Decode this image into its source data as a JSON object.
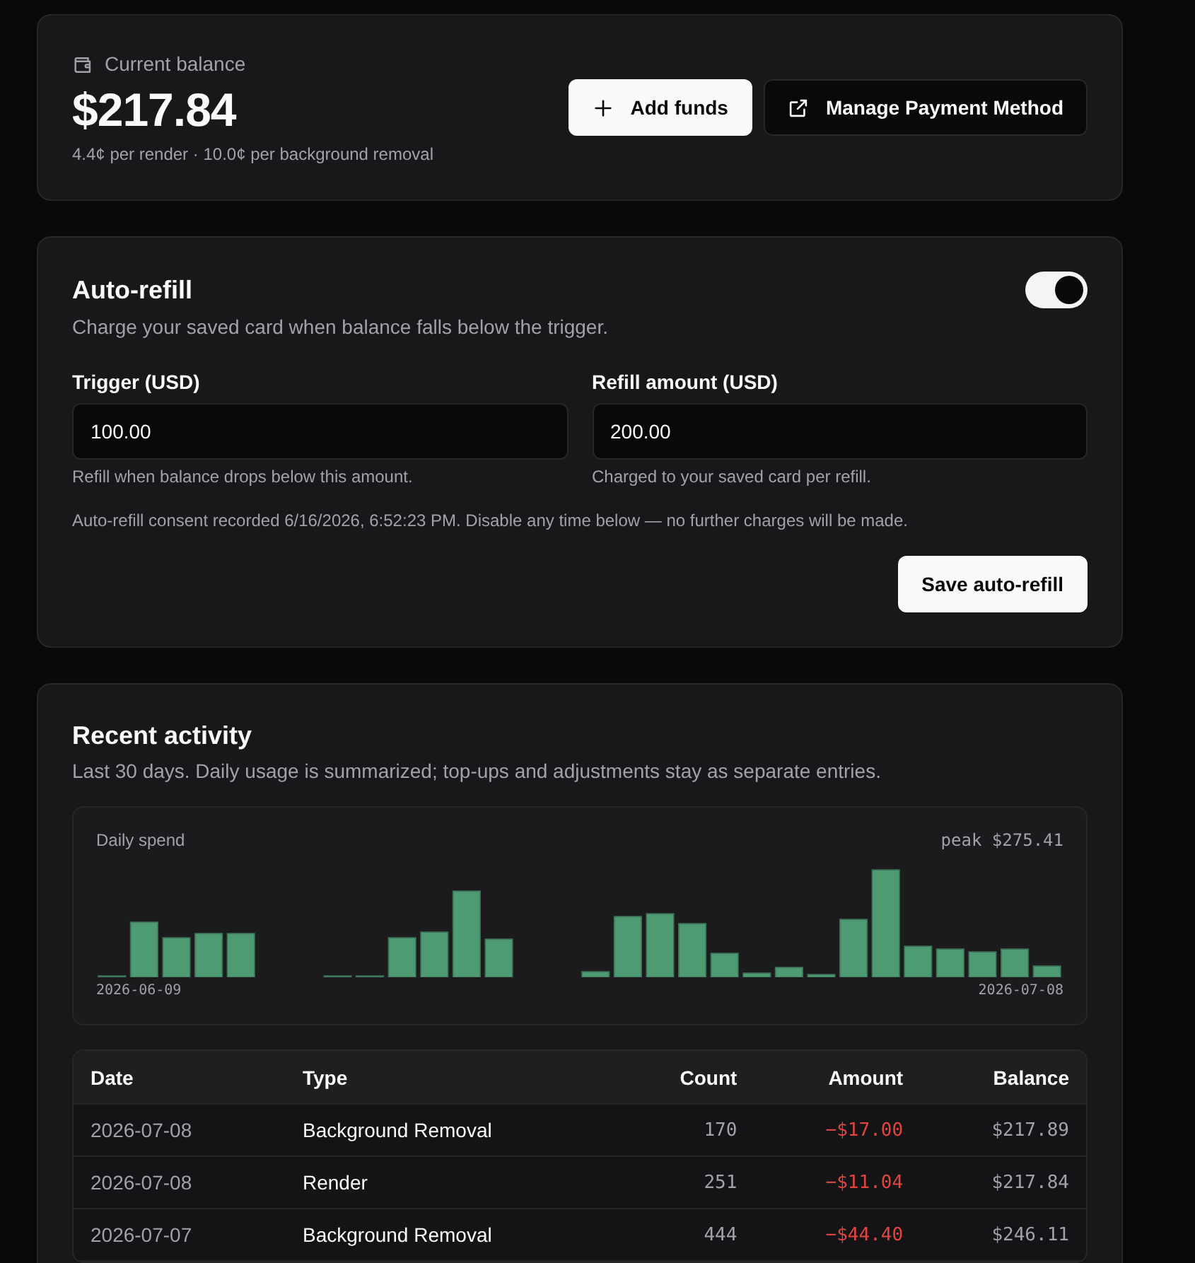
{
  "balance_card": {
    "label": "Current balance",
    "amount": "$217.84",
    "rates": "4.4¢ per render · 10.0¢ per background removal",
    "buttons": [
      {
        "label": "Add funds",
        "kind": "add"
      },
      {
        "label": "Manage Payment Method",
        "kind": "link"
      }
    ]
  },
  "auto_refill": {
    "title": "Auto-refill",
    "description": "Charge your saved card when balance falls below the trigger.",
    "on": true,
    "fields": [
      {
        "label": "Trigger (USD)",
        "value": "100.00",
        "hint": "Refill when balance drops below this amount."
      },
      {
        "label": "Refill amount (USD)",
        "value": "200.00",
        "hint": "Charged to your saved card per refill."
      }
    ],
    "consent": "Auto-refill consent recorded 6/16/2026, 6:52:23 PM. Disable any time below — no further charges will be made.",
    "save_button": "Save auto-refill"
  },
  "activity": {
    "title": "Recent activity",
    "description": "Last 30 days. Daily usage is summarized; top-ups and adjustments stay as separate entries.",
    "chart": {
      "title": "Daily spend",
      "peak": "peak $275.41",
      "start_date": "2026-06-09",
      "end_date": "2026-07-08"
    },
    "table": {
      "columns": [
        "Date",
        "Type",
        "Count",
        "Amount",
        "Balance"
      ],
      "rows": [
        {
          "date": "2026-07-08",
          "type": "Background Removal",
          "count": "170",
          "amount": "−$17.00",
          "balance": "$217.89"
        },
        {
          "date": "2026-07-08",
          "type": "Render",
          "count": "251",
          "amount": "−$11.04",
          "balance": "$217.84"
        },
        {
          "date": "2026-07-07",
          "type": "Background Removal",
          "count": "444",
          "amount": "−$44.40",
          "balance": "$246.11"
        }
      ]
    }
  }
}
